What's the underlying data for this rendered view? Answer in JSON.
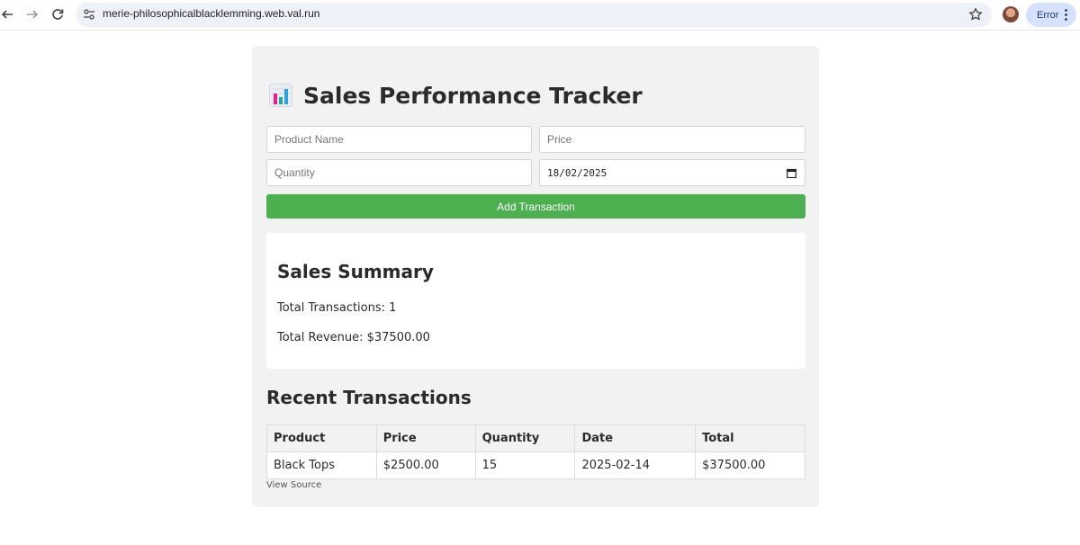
{
  "browser": {
    "url": "merie-philosophicalblacklemming.web.val.run",
    "error_label": "Error"
  },
  "app": {
    "title": "Sales Performance Tracker",
    "form": {
      "product_placeholder": "Product Name",
      "price_placeholder": "Price",
      "quantity_placeholder": "Quantity",
      "date_value": "18/02/2025",
      "submit_label": "Add Transaction"
    },
    "summary": {
      "heading": "Sales Summary",
      "total_transactions": "Total Transactions: 1",
      "total_revenue": "Total Revenue: $37500.00"
    },
    "recent": {
      "heading": "Recent Transactions",
      "columns": [
        "Product",
        "Price",
        "Quantity",
        "Date",
        "Total"
      ],
      "rows": [
        [
          "Black Tops",
          "$2500.00",
          "15",
          "2025-02-14",
          "$37500.00"
        ]
      ]
    },
    "view_source_label": "View Source"
  },
  "colors": {
    "primary_button": "#4caf50",
    "card_background": "#f2f2f2"
  },
  "icons": {
    "title_icon": "bar-chart-icon",
    "back": "arrow-left-icon",
    "forward": "arrow-right-icon",
    "reload": "reload-icon",
    "site_info": "tune-icon",
    "bookmark": "star-icon",
    "menu": "more-vert-icon"
  }
}
